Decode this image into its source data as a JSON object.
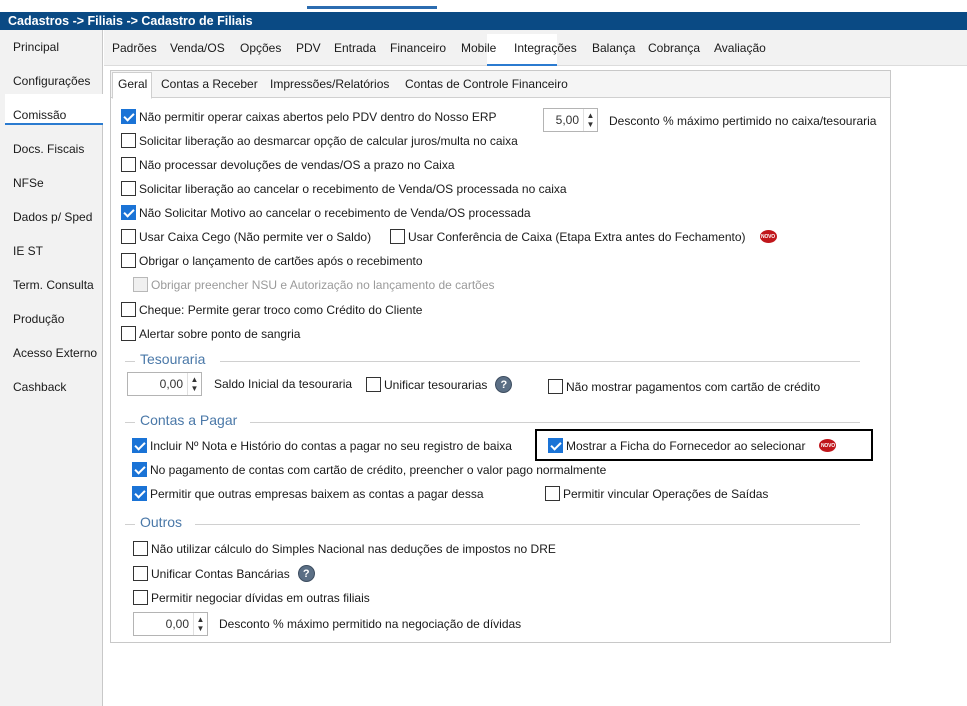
{
  "title": "Cadastros -> Filiais -> Cadastro de Filiais",
  "sidebar": {
    "items": [
      "Principal",
      "Configurações",
      "Comissão",
      "Docs. Fiscais",
      "NFSe",
      "Dados p/ Sped",
      "IE ST",
      "Term. Consulta",
      "Produção",
      "Acesso Externo",
      "Cashback"
    ],
    "active": "Configurações"
  },
  "main_tabs": {
    "items": [
      "Padrões",
      "Venda/OS",
      "Opções",
      "PDV",
      "Entrada",
      "Financeiro",
      "Mobile",
      "Integrações",
      "Balança",
      "Cobrança",
      "Avaliação"
    ],
    "active": "Financeiro"
  },
  "sub_tabs": {
    "items": [
      "Geral",
      "Contas a Receber",
      "Impressões/Relatórios",
      "Contas de Controle Financeiro"
    ],
    "active": "Geral"
  },
  "options": [
    {
      "label": "Não permitir operar caixas abertos pelo PDV dentro do Nosso ERP",
      "checked": true
    },
    {
      "label": "Solicitar liberação ao desmarcar opção de calcular juros/multa no caixa",
      "checked": false
    },
    {
      "label": "Não processar devoluções de vendas/OS a prazo no Caixa",
      "checked": false
    },
    {
      "label": "Solicitar liberação ao cancelar o recebimento de Venda/OS processada no caixa",
      "checked": false
    },
    {
      "label": "Não Solicitar Motivo ao cancelar o recebimento de Venda/OS processada",
      "checked": true
    },
    {
      "label": "Usar Caixa Cego (Não permite ver o Saldo)",
      "checked": false
    },
    {
      "label": "Usar Conferência de Caixa (Etapa Extra antes do Fechamento)",
      "checked": false
    },
    {
      "label": "Obrigar o lançamento de cartões após o recebimento",
      "checked": false
    },
    {
      "label": "Obrigar preencher NSU e Autorização no lançamento de cartões",
      "checked": false,
      "disabled": true
    },
    {
      "label": "Cheque: Permite gerar troco como Crédito do Cliente",
      "checked": false
    },
    {
      "label": "Alertar sobre ponto de sangria",
      "checked": false
    }
  ],
  "desconto_caixa": {
    "value": "5,00",
    "label": "Desconto % máximo pertimido no caixa/tesouraria"
  },
  "badge_text": "NOVO",
  "help_symbol": "?",
  "tesouraria": {
    "title": "Tesouraria",
    "saldo_value": "0,00",
    "saldo_label": "Saldo Inicial da tesouraria",
    "unificar": {
      "label": "Unificar tesourarias",
      "checked": false
    },
    "nao_mostrar": {
      "label": "Não mostrar pagamentos com cartão de crédito",
      "checked": false
    }
  },
  "contas_pagar": {
    "title": "Contas a Pagar",
    "options": [
      {
        "label": "Incluir Nº Nota e Histório do contas a pagar no seu registro de baixa",
        "checked": true
      },
      {
        "label": "Mostrar a Ficha do Fornecedor ao selecionar",
        "checked": true
      },
      {
        "label": "No pagamento de contas com cartão de crédito, preencher o valor pago normalmente",
        "checked": true
      },
      {
        "label": "Permitir que outras empresas baixem as contas a pagar dessa",
        "checked": true
      },
      {
        "label": "Permitir vincular Operações de Saídas",
        "checked": false
      }
    ]
  },
  "outros": {
    "title": "Outros",
    "options": [
      {
        "label": "Não utilizar cálculo do Simples Nacional nas deduções de impostos no DRE",
        "checked": false
      },
      {
        "label": "Unificar Contas Bancárias",
        "checked": false
      },
      {
        "label": "Permitir negociar dívidas em outras filiais",
        "checked": false
      }
    ],
    "desconto_value": "0,00",
    "desconto_label": "Desconto % máximo permitido na negociação de dívidas"
  },
  "colors": {
    "title_bar": "#0a4a84",
    "accent": "#1a73d6",
    "section": "#4a78a8",
    "badge": "#c0161b"
  }
}
